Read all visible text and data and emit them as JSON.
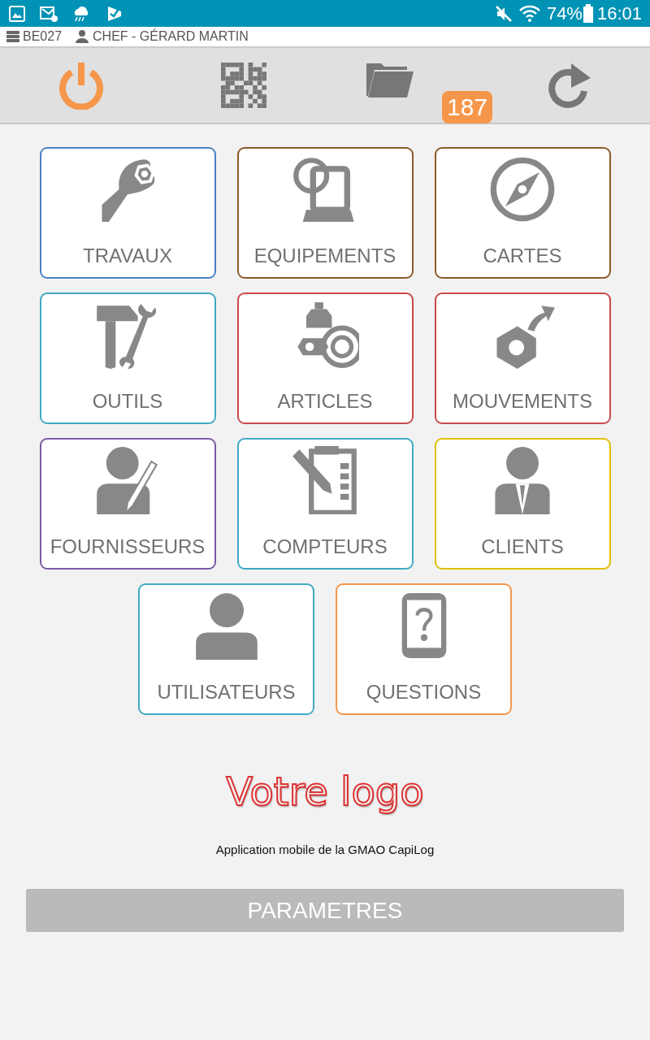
{
  "status_bar": {
    "battery": "74%",
    "time": "16:01"
  },
  "info_bar": {
    "site": "BE027",
    "user": "CHEF - GÉRARD MARTIN"
  },
  "toolbar": {
    "folder_badge": "187"
  },
  "tiles": [
    {
      "kind": "works",
      "label": "TRAVAUX",
      "color": "#4a7fc1"
    },
    {
      "kind": "equipment",
      "label": "EQUIPEMENTS",
      "color": "#8b5a2b"
    },
    {
      "kind": "maps",
      "label": "CARTES",
      "color": "#8b5a2b"
    },
    {
      "kind": "tools",
      "label": "OUTILS",
      "color": "#3fa9c4"
    },
    {
      "kind": "articles",
      "label": "ARTICLES",
      "color": "#c94a4a"
    },
    {
      "kind": "moves",
      "label": "MOUVEMENTS",
      "color": "#c94a4a"
    },
    {
      "kind": "suppliers",
      "label": "FOURNISSEURS",
      "color": "#7b5aa6"
    },
    {
      "kind": "counters",
      "label": "COMPTEURS",
      "color": "#3fa9c4"
    },
    {
      "kind": "clients",
      "label": "CLIENTS",
      "color": "#e0c000"
    },
    {
      "kind": "users",
      "label": "UTILISATEURS",
      "color": "#3fa9c4"
    },
    {
      "kind": "questions",
      "label": "QUESTIONS",
      "color": "#f5964a"
    }
  ],
  "logo": "Votre logo",
  "caption": "Application mobile de la GMAO CapiLog",
  "settings_button": "PARAMETRES"
}
